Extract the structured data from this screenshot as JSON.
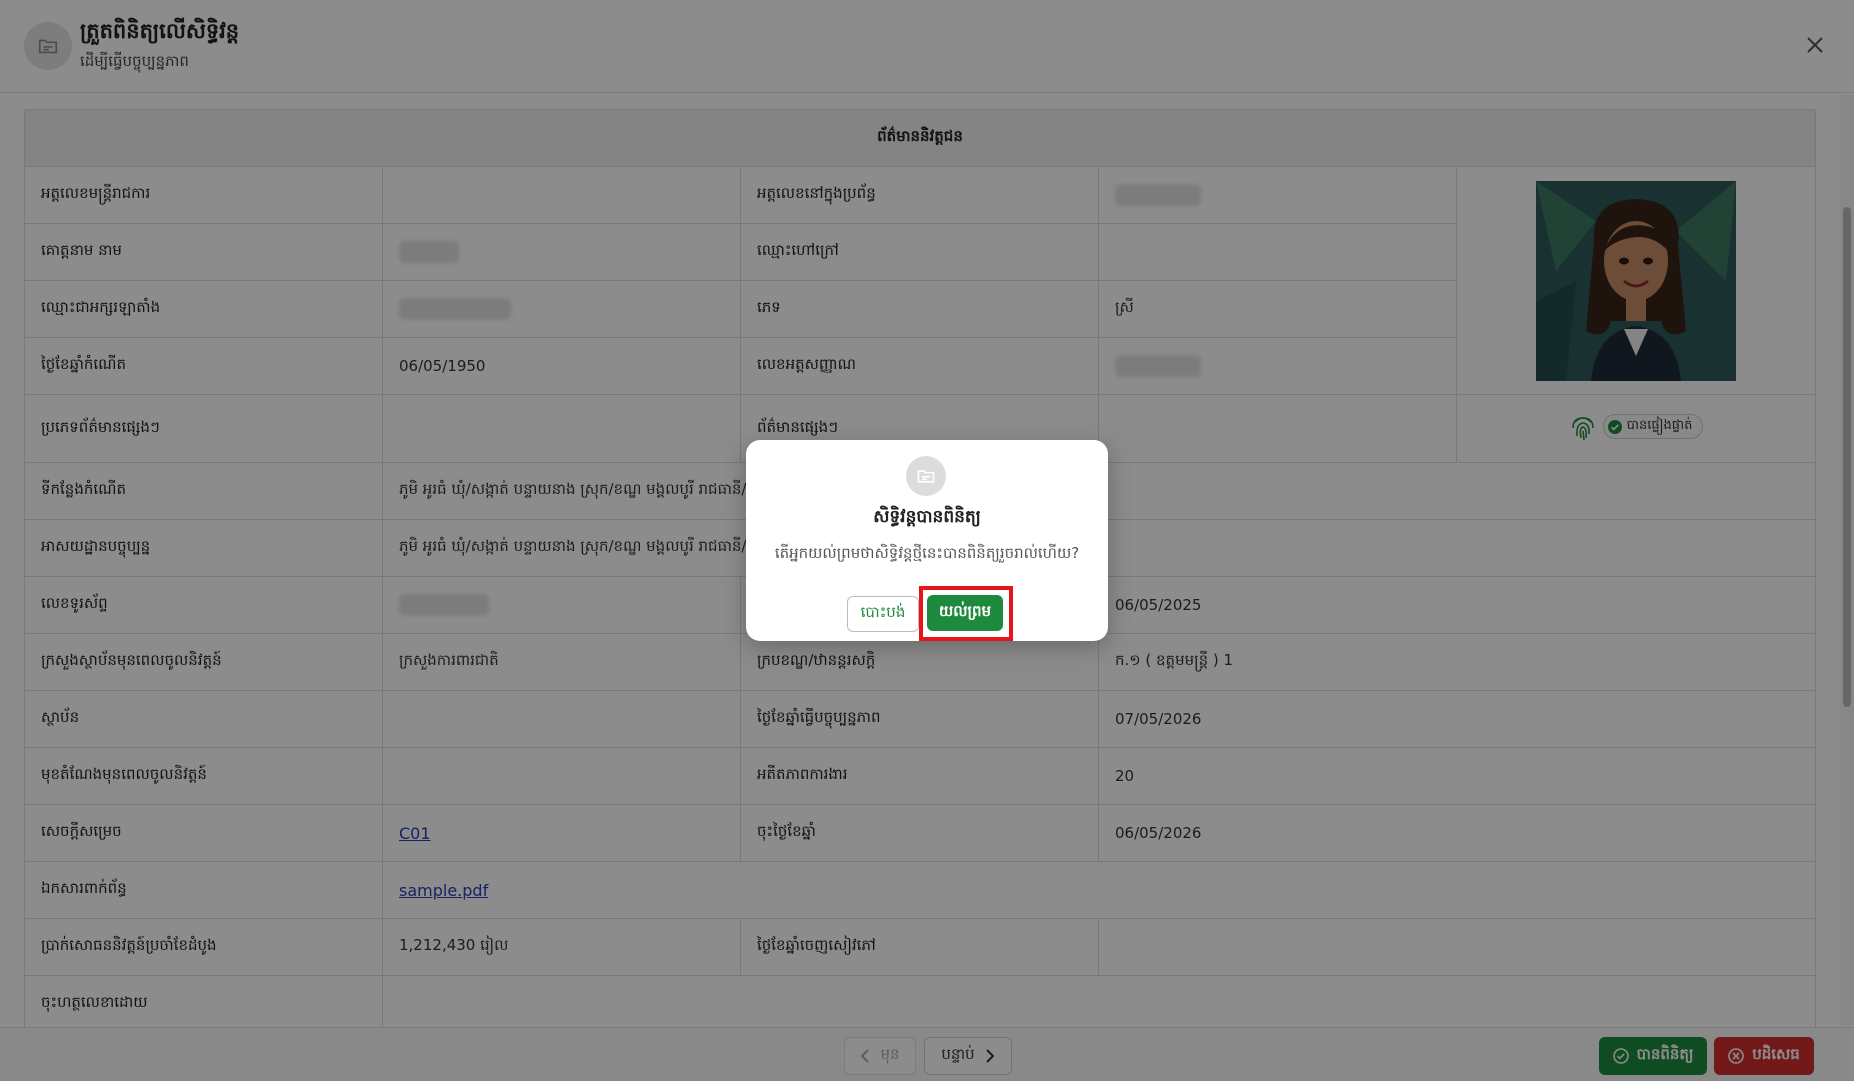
{
  "header": {
    "title": "ត្រួតពិនិត្យលើសិទ្ធិវន្ត",
    "subtitle": "ដើម្បីធ្វើបច្ចុប្បន្នភាព"
  },
  "section_title": "ព័ត៌មាននិវត្តជន",
  "fields": {
    "officer_id_label": "អត្តលេខមន្ត្រីរាជការ",
    "system_id_label": "អត្តលេខនៅក្នុងប្រព័ន្ធ",
    "surname_name_label": "គោត្តនាម នាម",
    "alias_label": "ឈ្មោះហៅក្រៅ",
    "latin_name_label": "ឈ្មោះជាអក្សរឡាតាំង",
    "sex_label": "ភេទ",
    "sex_value": "ស្រី",
    "dob_label": "ថ្ងៃខែឆ្នាំកំណើត",
    "dob_value": "06/05/1950",
    "id_card_label": "លេខអត្តសញ្ញាណ",
    "other_info_type_label": "ប្រភេទព័ត៌មានផ្សេងៗ",
    "other_info_label": "ព័ត៌មានផ្សេងៗ",
    "verified_chip": "បានផ្ទៀងផ្ទាត់",
    "birthplace_label": "ទីកន្លែងកំណើត",
    "birthplace_value": "ភូមិ អូរធំ ឃុំ/សង្កាត់ បន្ទាយនាង ស្រុក/ខណ្ឌ មង្គលបូរី រាជធានី/ខេត្ត បន្ទាយមានជ័យ",
    "current_address_label": "អាសយដ្ឋានបច្ចុប្បន្ន",
    "current_address_value": "ភូមិ អូរធំ ឃុំ/សង្កាត់ បន្ទាយនាង ស្រុក/ខណ្ឌ មង្គលបូរី រាជធានី/ខេត្ត បន្ទាយមានជ័យ",
    "phone_label": "លេខទូរស័ព្ទ",
    "retire_date_value": "06/05/2025",
    "ministry_label": "ក្រសួងស្ថាប័នមុនពេលចូលនិវត្តន៍",
    "ministry_value": "ក្រសួងការពារជាតិ",
    "rank_label": "ក្របខណ្ឌ/ឋានន្តរសក្តិ",
    "rank_value": "ក.១ ( ឧត្តមមន្ត្រី ) 1",
    "institution_label": "ស្ថាប័ន",
    "update_date_label": "ថ្ងៃខែឆ្នាំធ្វើបច្ចុប្បន្នភាព",
    "update_date_value": "07/05/2026",
    "position_label": "មុខតំណែងមុនពេលចូលនិវត្តន៍",
    "seniority_label": "អតីតភាពការងារ",
    "seniority_value": "20",
    "decision_label": "សេចក្តីសម្រេច",
    "decision_value": "C01",
    "sign_date_label": "ចុះថ្ងៃខែឆ្នាំ",
    "sign_date_value": "06/05/2026",
    "attachment_label": "ឯកសារពាក់ព័ន្ធ",
    "attachment_value": "sample.pdf",
    "pension_label": "ប្រាក់សោធននិវត្តន៍ប្រចាំខែដំបូង",
    "pension_value": "1,212,430 រៀល",
    "booklet_date_label": "ថ្ងៃខែឆ្នាំចេញសៀវភៅ",
    "signed_by_label": "ចុះហត្ថលេខាដោយ"
  },
  "footer": {
    "prev_label": "មុន",
    "next_label": "បន្ទាប់",
    "approve_label": "បានពិនិត្យ",
    "reject_label": "បដិសេធ"
  },
  "modal": {
    "title": "សិទ្ធិវន្តបានពិនិត្យ",
    "message": "តើអ្នកយល់ព្រមថាសិទ្ធិវន្តថ្មីនេះបានពិនិត្យរួចរាល់ហើយ?",
    "cancel_label": "បោះបង់",
    "confirm_label": "យល់ព្រម"
  },
  "colors": {
    "primary_green": "#1e8a3e",
    "danger_red": "#d32f2f",
    "highlight_red": "#e8141b"
  }
}
